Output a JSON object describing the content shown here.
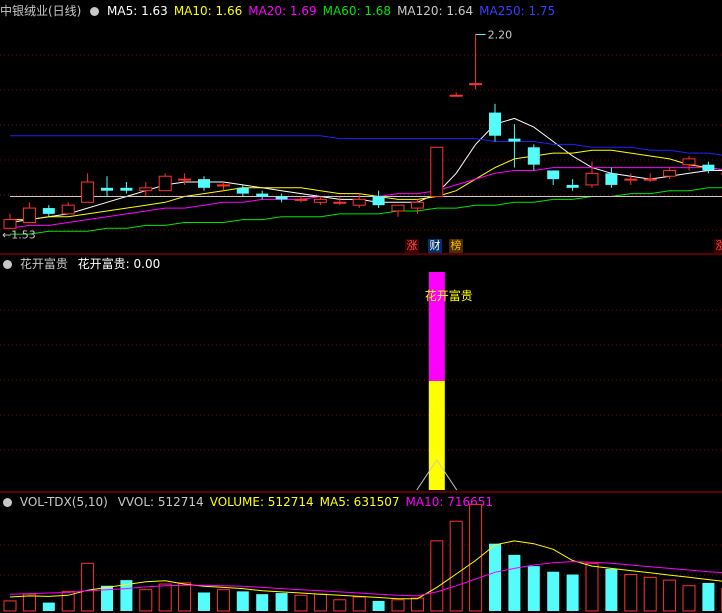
{
  "colors": {
    "up": "#ff3232",
    "down": "#54fcfc",
    "ma5": "#ffffff",
    "ma10": "#ffff00",
    "ma20": "#ff00ff",
    "ma60": "#00e600",
    "ma120": "#c8c8c8",
    "ma250": "#2020ff",
    "grid": "#8b0000",
    "separator": "#b40000",
    "flower_top": "#ff00ff",
    "flower_bottom": "#ffff00"
  },
  "price_panel": {
    "title": "中银绒业(日线)",
    "mas": [
      {
        "label": "MA5: 1.63",
        "color": "#ffffff"
      },
      {
        "label": "MA10: 1.66",
        "color": "#ffff00"
      },
      {
        "label": "MA20: 1.69",
        "color": "#ff00ff"
      },
      {
        "label": "MA60: 1.68",
        "color": "#00e600"
      },
      {
        "label": "MA120: 1.64",
        "color": "#c8c8c8"
      },
      {
        "label": "MA250: 1.75",
        "color": "#3c3cff"
      }
    ],
    "high_label": "2.20",
    "low_label": "←1.53",
    "badges": [
      {
        "text": "涨",
        "color": "#ff5050",
        "bg": "#3a0000"
      },
      {
        "text": "财",
        "color": "#ffffff",
        "bg": "#00306a"
      },
      {
        "text": "榜",
        "color": "#ffc000",
        "bg": "#4a2a00"
      },
      {
        "text": "涨",
        "color": "#ff5050",
        "bg": "#3a0000"
      }
    ]
  },
  "flower_panel": {
    "title": "花开富贵",
    "value_label": "花开富贵: 0.00",
    "signal_label": "花开富贵"
  },
  "volume_panel": {
    "title": "VOL-TDX(5,10)",
    "fields": [
      {
        "label": "VVOL: 512714",
        "color": "#c8c8c8"
      },
      {
        "label": "VOLUME: 512714",
        "color": "#ffff00"
      },
      {
        "label": "MA5: 631507",
        "color": "#ffff00"
      },
      {
        "label": "MA10: 716651",
        "color": "#ff00ff"
      }
    ]
  },
  "chart_data": [
    {
      "type": "candlestick",
      "title": "中银绒业(日线)",
      "ylim": [
        1.5,
        2.25
      ],
      "high_marker": 2.2,
      "low_marker": 1.53,
      "candles": [
        {
          "o": 1.53,
          "h": 1.58,
          "l": 1.53,
          "c": 1.56
        },
        {
          "o": 1.55,
          "h": 1.62,
          "l": 1.55,
          "c": 1.6
        },
        {
          "o": 1.6,
          "h": 1.61,
          "l": 1.57,
          "c": 1.58
        },
        {
          "o": 1.58,
          "h": 1.62,
          "l": 1.58,
          "c": 1.61
        },
        {
          "o": 1.62,
          "h": 1.72,
          "l": 1.62,
          "c": 1.69
        },
        {
          "o": 1.67,
          "h": 1.71,
          "l": 1.64,
          "c": 1.66
        },
        {
          "o": 1.67,
          "h": 1.69,
          "l": 1.65,
          "c": 1.66
        },
        {
          "o": 1.66,
          "h": 1.69,
          "l": 1.64,
          "c": 1.67
        },
        {
          "o": 1.66,
          "h": 1.72,
          "l": 1.66,
          "c": 1.71
        },
        {
          "o": 1.7,
          "h": 1.72,
          "l": 1.68,
          "c": 1.7
        },
        {
          "o": 1.7,
          "h": 1.71,
          "l": 1.66,
          "c": 1.67
        },
        {
          "o": 1.68,
          "h": 1.69,
          "l": 1.66,
          "c": 1.68
        },
        {
          "o": 1.67,
          "h": 1.68,
          "l": 1.64,
          "c": 1.65
        },
        {
          "o": 1.65,
          "h": 1.66,
          "l": 1.63,
          "c": 1.64
        },
        {
          "o": 1.64,
          "h": 1.65,
          "l": 1.62,
          "c": 1.63
        },
        {
          "o": 1.63,
          "h": 1.64,
          "l": 1.62,
          "c": 1.63
        },
        {
          "o": 1.62,
          "h": 1.64,
          "l": 1.61,
          "c": 1.63
        },
        {
          "o": 1.62,
          "h": 1.64,
          "l": 1.61,
          "c": 1.62
        },
        {
          "o": 1.61,
          "h": 1.65,
          "l": 1.6,
          "c": 1.63
        },
        {
          "o": 1.64,
          "h": 1.66,
          "l": 1.6,
          "c": 1.61
        },
        {
          "o": 1.59,
          "h": 1.61,
          "l": 1.57,
          "c": 1.61
        },
        {
          "o": 1.6,
          "h": 1.63,
          "l": 1.58,
          "c": 1.62
        },
        {
          "o": 1.64,
          "h": 1.81,
          "l": 1.64,
          "c": 1.81
        },
        {
          "o": 1.99,
          "h": 2.0,
          "l": 1.99,
          "c": 1.99
        },
        {
          "o": 2.03,
          "h": 2.2,
          "l": 2.01,
          "c": 2.03
        },
        {
          "o": 1.93,
          "h": 1.96,
          "l": 1.83,
          "c": 1.85
        },
        {
          "o": 1.84,
          "h": 1.89,
          "l": 1.74,
          "c": 1.83
        },
        {
          "o": 1.81,
          "h": 1.82,
          "l": 1.73,
          "c": 1.75
        },
        {
          "o": 1.73,
          "h": 1.73,
          "l": 1.68,
          "c": 1.7
        },
        {
          "o": 1.68,
          "h": 1.7,
          "l": 1.66,
          "c": 1.67
        },
        {
          "o": 1.68,
          "h": 1.76,
          "l": 1.67,
          "c": 1.72
        },
        {
          "o": 1.72,
          "h": 1.74,
          "l": 1.67,
          "c": 1.68
        },
        {
          "o": 1.7,
          "h": 1.72,
          "l": 1.68,
          "c": 1.7
        },
        {
          "o": 1.7,
          "h": 1.72,
          "l": 1.69,
          "c": 1.7
        },
        {
          "o": 1.71,
          "h": 1.74,
          "l": 1.7,
          "c": 1.73
        },
        {
          "o": 1.75,
          "h": 1.78,
          "l": 1.73,
          "c": 1.77
        },
        {
          "o": 1.75,
          "h": 1.76,
          "l": 1.72,
          "c": 1.73
        },
        {
          "o": 1.72,
          "h": 1.74,
          "l": 1.71,
          "c": 1.72
        },
        {
          "o": 1.72,
          "h": 1.73,
          "l": 1.69,
          "c": 1.7
        }
      ],
      "ma_series": {
        "ma5": [
          1.55,
          1.56,
          1.57,
          1.58,
          1.6,
          1.62,
          1.64,
          1.66,
          1.68,
          1.69,
          1.69,
          1.69,
          1.68,
          1.67,
          1.66,
          1.65,
          1.64,
          1.63,
          1.63,
          1.62,
          1.62,
          1.62,
          1.65,
          1.72,
          1.82,
          1.89,
          1.91,
          1.88,
          1.83,
          1.78,
          1.74,
          1.72,
          1.71,
          1.7,
          1.71,
          1.72,
          1.73,
          1.73,
          1.72
        ],
        "ma10": [
          1.56,
          1.56,
          1.57,
          1.57,
          1.58,
          1.59,
          1.6,
          1.61,
          1.62,
          1.64,
          1.65,
          1.66,
          1.67,
          1.67,
          1.67,
          1.67,
          1.66,
          1.65,
          1.65,
          1.64,
          1.63,
          1.63,
          1.64,
          1.66,
          1.7,
          1.74,
          1.77,
          1.78,
          1.79,
          1.79,
          1.8,
          1.8,
          1.79,
          1.78,
          1.77,
          1.75,
          1.74,
          1.73,
          1.73
        ],
        "ma20": [
          1.53,
          1.54,
          1.54,
          1.55,
          1.56,
          1.57,
          1.58,
          1.59,
          1.6,
          1.6,
          1.61,
          1.62,
          1.62,
          1.63,
          1.63,
          1.63,
          1.64,
          1.64,
          1.64,
          1.64,
          1.65,
          1.65,
          1.66,
          1.68,
          1.7,
          1.72,
          1.73,
          1.73,
          1.74,
          1.74,
          1.74,
          1.74,
          1.74,
          1.74,
          1.74,
          1.74,
          1.74,
          1.73,
          1.73
        ],
        "ma60": [
          1.51,
          1.51,
          1.52,
          1.52,
          1.52,
          1.53,
          1.53,
          1.54,
          1.54,
          1.55,
          1.55,
          1.55,
          1.56,
          1.56,
          1.57,
          1.57,
          1.57,
          1.58,
          1.58,
          1.58,
          1.59,
          1.59,
          1.6,
          1.6,
          1.61,
          1.61,
          1.62,
          1.62,
          1.63,
          1.63,
          1.64,
          1.64,
          1.65,
          1.65,
          1.66,
          1.66,
          1.67,
          1.67,
          1.68
        ],
        "ma120": [
          1.64,
          1.64,
          1.64,
          1.64,
          1.64,
          1.64,
          1.64,
          1.64,
          1.64,
          1.64,
          1.64,
          1.64,
          1.64,
          1.64,
          1.64,
          1.64,
          1.64,
          1.64,
          1.64,
          1.64,
          1.64,
          1.64,
          1.64,
          1.64,
          1.64,
          1.64,
          1.64,
          1.64,
          1.64,
          1.64,
          1.64,
          1.64,
          1.64,
          1.64,
          1.64,
          1.64,
          1.64,
          1.64,
          1.64
        ],
        "ma250": [
          1.85,
          1.85,
          1.85,
          1.85,
          1.85,
          1.85,
          1.85,
          1.85,
          1.85,
          1.85,
          1.85,
          1.85,
          1.85,
          1.85,
          1.85,
          1.85,
          1.85,
          1.84,
          1.84,
          1.84,
          1.84,
          1.84,
          1.84,
          1.84,
          1.84,
          1.83,
          1.83,
          1.83,
          1.82,
          1.82,
          1.81,
          1.81,
          1.81,
          1.8,
          1.8,
          1.79,
          1.79,
          1.78,
          1.78
        ]
      }
    },
    {
      "type": "bar",
      "title": "花开富贵",
      "signal_index": 22,
      "signal_segments": [
        {
          "from": 0.5,
          "to": 1.0,
          "color": "#ff00ff"
        },
        {
          "from": 0.0,
          "to": 0.5,
          "color": "#ffff00"
        }
      ],
      "value": 0.0
    },
    {
      "type": "bar",
      "title": "VOL-TDX(5,10)",
      "ylim": [
        0,
        1800000
      ],
      "values": [
        180000,
        300000,
        150000,
        350000,
        850000,
        450000,
        550000,
        380000,
        480000,
        500000,
        330000,
        380000,
        350000,
        300000,
        320000,
        280000,
        300000,
        200000,
        250000,
        180000,
        200000,
        230000,
        1250000,
        1600000,
        1900000,
        1200000,
        1000000,
        800000,
        700000,
        650000,
        850000,
        750000,
        650000,
        600000,
        550000,
        450000,
        500000,
        400000,
        350000
      ],
      "ma5": [
        250000,
        270000,
        260000,
        280000,
        370000,
        420000,
        470000,
        520000,
        540000,
        480000,
        440000,
        420000,
        400000,
        360000,
        340000,
        320000,
        300000,
        280000,
        260000,
        240000,
        220000,
        220000,
        420000,
        660000,
        900000,
        1180000,
        1250000,
        1200000,
        1100000,
        900000,
        800000,
        760000,
        720000,
        680000,
        640000,
        600000,
        560000,
        520000,
        480000
      ],
      "ma10": [
        300000,
        310000,
        320000,
        330000,
        360000,
        380000,
        400000,
        430000,
        450000,
        460000,
        460000,
        450000,
        440000,
        420000,
        400000,
        380000,
        360000,
        340000,
        320000,
        300000,
        280000,
        270000,
        340000,
        450000,
        570000,
        690000,
        760000,
        820000,
        860000,
        880000,
        870000,
        850000,
        820000,
        790000,
        760000,
        730000,
        700000,
        680000,
        660000
      ]
    }
  ]
}
